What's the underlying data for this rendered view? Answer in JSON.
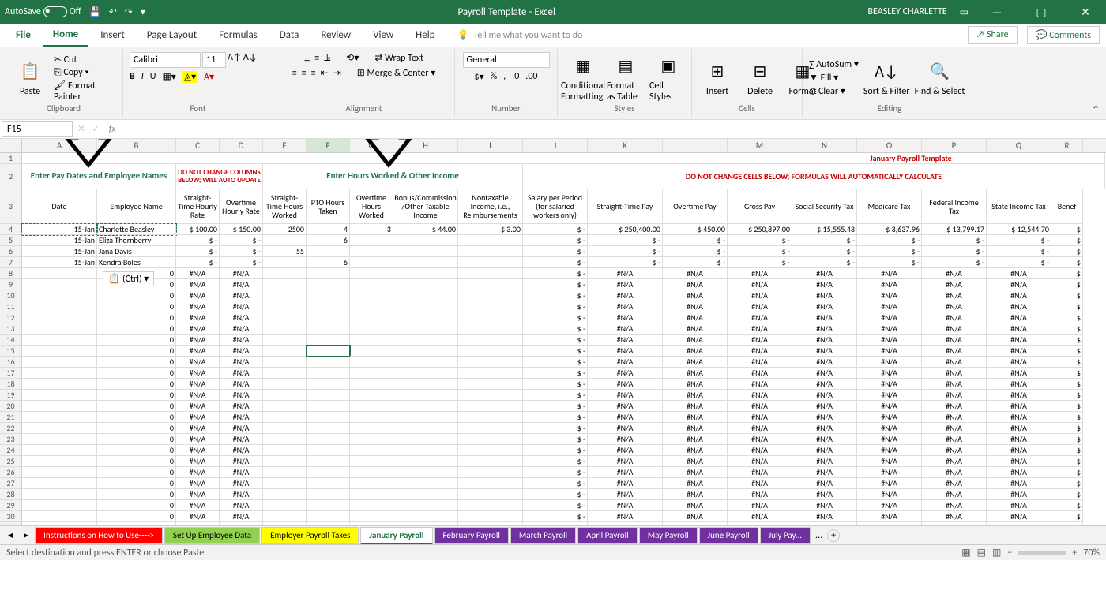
{
  "titlebar": {
    "autosave": "AutoSave",
    "off": "Off",
    "title": "Payroll Template - Excel",
    "user": "BEASLEY CHARLETTE"
  },
  "tabs": {
    "file": "File",
    "home": "Home",
    "insert": "Insert",
    "page": "Page Layout",
    "formulas": "Formulas",
    "data": "Data",
    "review": "Review",
    "view": "View",
    "help": "Help",
    "tell": "Tell me what you want to do",
    "share": "Share",
    "comments": "Comments"
  },
  "ribbon": {
    "clipboard": {
      "label": "Clipboard",
      "paste": "Paste",
      "cut": "Cut",
      "copy": "Copy",
      "painter": "Format Painter"
    },
    "font": {
      "label": "Font",
      "name": "Calibri",
      "size": "11"
    },
    "alignment": {
      "label": "Alignment",
      "wrap": "Wrap Text",
      "merge": "Merge & Center"
    },
    "number": {
      "label": "Number",
      "format": "General"
    },
    "styles": {
      "label": "Styles",
      "cf": "Conditional Formatting",
      "fas": "Format as Table",
      "cs": "Cell Styles"
    },
    "cells": {
      "label": "Cells",
      "insert": "Insert",
      "delete": "Delete",
      "format": "Format"
    },
    "editing": {
      "label": "Editing",
      "autosum": "AutoSum",
      "fill": "Fill",
      "clear": "Clear",
      "sort": "Sort & Filter",
      "find": "Find & Select"
    }
  },
  "namebox": {
    "ref": "F15"
  },
  "sheet": {
    "title": "January Payroll Template",
    "enter_names": "Enter Pay Dates and Employee Names",
    "donotchange": "DO NOT CHANGE COLUMNS BELOW; WILL AUTO UPDATE",
    "enter_hours": "Enter Hours Worked & Other Income",
    "donotchange2": "DO NOT CHANGE CELLS BELOW; FORMULAS WILL AUTOMATICALLY CALCULATE",
    "cols": [
      "Date",
      "Employee Name",
      "Straight-Time Hourly Rate",
      "Overtime Hourly Rate",
      "Straight-Time Hours Worked",
      "PTO Hours Taken",
      "Overtime Hours Worked",
      "Bonus/Commission /Other Taxable Income",
      "Nontaxable Income, i.e., Reimbursements",
      "Salary per Period (for salaried workers only)",
      "Straight-Time Pay",
      "Overtime Pay",
      "Gross Pay",
      "Social Security Tax",
      "Medicare Tax",
      "Federal Income Tax",
      "State Income Tax",
      "Benef"
    ],
    "rows": [
      {
        "date": "15-Jan",
        "name": "Charlette Beasley",
        "c": "$    100.00",
        "d": "$    150.00",
        "e": "2500",
        "f": "4",
        "g": "3",
        "h": "$           44.00",
        "i": "$             3.00",
        "j": "$                -",
        "k": "250,400.00",
        "l": "450.00",
        "m": "250,897.00",
        "n": "15,555.43",
        "o": "3,637.96",
        "p": "13,799.17",
        "q": "12,544.70"
      },
      {
        "date": "15-Jan",
        "name": "Eliza Thornberry",
        "c": "$            -",
        "d": "$            -",
        "e": "",
        "f": "6",
        "g": "",
        "h": "",
        "i": "",
        "j": "$                -",
        "k": "-",
        "l": "-",
        "m": "-",
        "n": "-",
        "o": "-",
        "p": "-",
        "q": "-"
      },
      {
        "date": "15-Jan",
        "name": "Jana Davis",
        "c": "$            -",
        "d": "$            -",
        "e": "55",
        "f": "",
        "g": "",
        "h": "",
        "i": "",
        "j": "$                -",
        "k": "-",
        "l": "-",
        "m": "-",
        "n": "-",
        "o": "-",
        "p": "-",
        "q": "-"
      },
      {
        "date": "15-Jan",
        "name": "Kendra Boles",
        "c": "$            -",
        "d": "$            -",
        "e": "",
        "f": "6",
        "g": "",
        "h": "",
        "i": "",
        "j": "$                -",
        "k": "-",
        "l": "-",
        "m": "-",
        "n": "-",
        "o": "-",
        "p": "-",
        "q": "-"
      }
    ],
    "na": "#N/A",
    "zero": "0",
    "dollar": "$",
    "ctrl": "(Ctrl) ▾"
  },
  "sheets": {
    "nav_prev": "◂",
    "nav_next": "▸",
    "more": "...",
    "s1": "Instructions on How to Use---->",
    "s2": "Set Up Employee Data",
    "s3": "Employer Payroll Taxes",
    "s4": "January Payroll",
    "s5": "February Payroll",
    "s6": "March Payroll",
    "s7": "April Payroll",
    "s8": "May Payroll",
    "s9": "June Payroll",
    "s10": "July Pay..."
  },
  "status": {
    "msg": "Select destination and press ENTER or choose Paste",
    "zoom": "70%"
  }
}
